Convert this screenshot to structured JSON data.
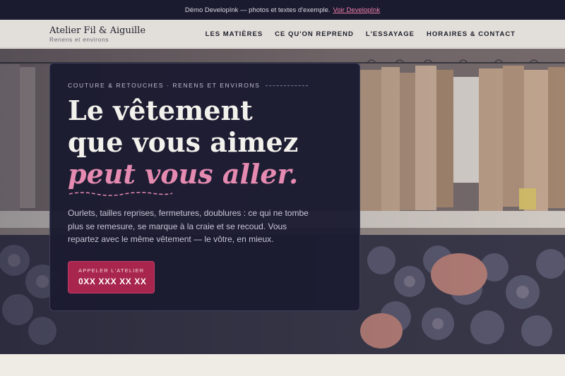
{
  "demo_bar": {
    "text": "Démo DevelopInk — photos et textes d'exemple.",
    "link": "Voir DevelopInk"
  },
  "header": {
    "brand_name": "Atelier Fil & Aiguille",
    "brand_sub": "Renens et environs",
    "nav": [
      {
        "label": "LES MATIÈRES"
      },
      {
        "label": "CE QU'ON REPREND"
      },
      {
        "label": "L'ESSAYAGE"
      },
      {
        "label": "HORAIRES & CONTACT"
      }
    ]
  },
  "hero": {
    "eyebrow": "COUTURE & RETOUCHES · RENENS ET ENVIRONS",
    "headline_line1": "Le vêtement",
    "headline_line2": "que vous aimez",
    "headline_accent": "peut vous aller.",
    "body": "Ourlets, tailles reprises, fermetures, doublures : ce qui ne tombe plus se remesure, se marque à la craie et se recoud. Vous repartez avec le même vêtement — le vôtre, en mieux.",
    "cta_label": "APPELER L'ATELIER",
    "cta_phone": "0XX XXX XX XX"
  },
  "colors": {
    "demo_bar_bg": "#1b1b30",
    "header_bg": "#e2dfda",
    "card_bg": "#1b1b31",
    "accent_pink": "#e58ab0",
    "cta_bg": "#a8254d"
  },
  "icons": {
    "underline": "squiggle-underline-icon"
  }
}
